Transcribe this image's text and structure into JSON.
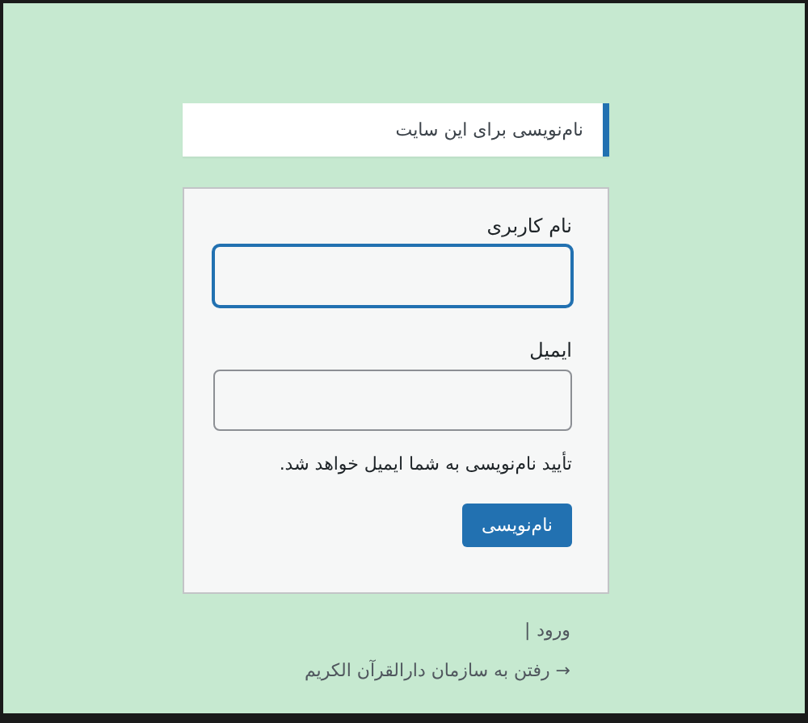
{
  "message": "نام‌نویسی برای این سایت",
  "form": {
    "fields": [
      {
        "label": "نام کاربری",
        "focused": true
      },
      {
        "label": "ایمیل",
        "focused": false
      }
    ],
    "note": "تأیید نام‌نویسی به شما ایمیل خواهد شد.",
    "submit": "نام‌نویسی"
  },
  "nav": {
    "login": "ورود",
    "separator": "|"
  },
  "back_link": "→ رفتن به سازمان دارالقرآن الکریم"
}
